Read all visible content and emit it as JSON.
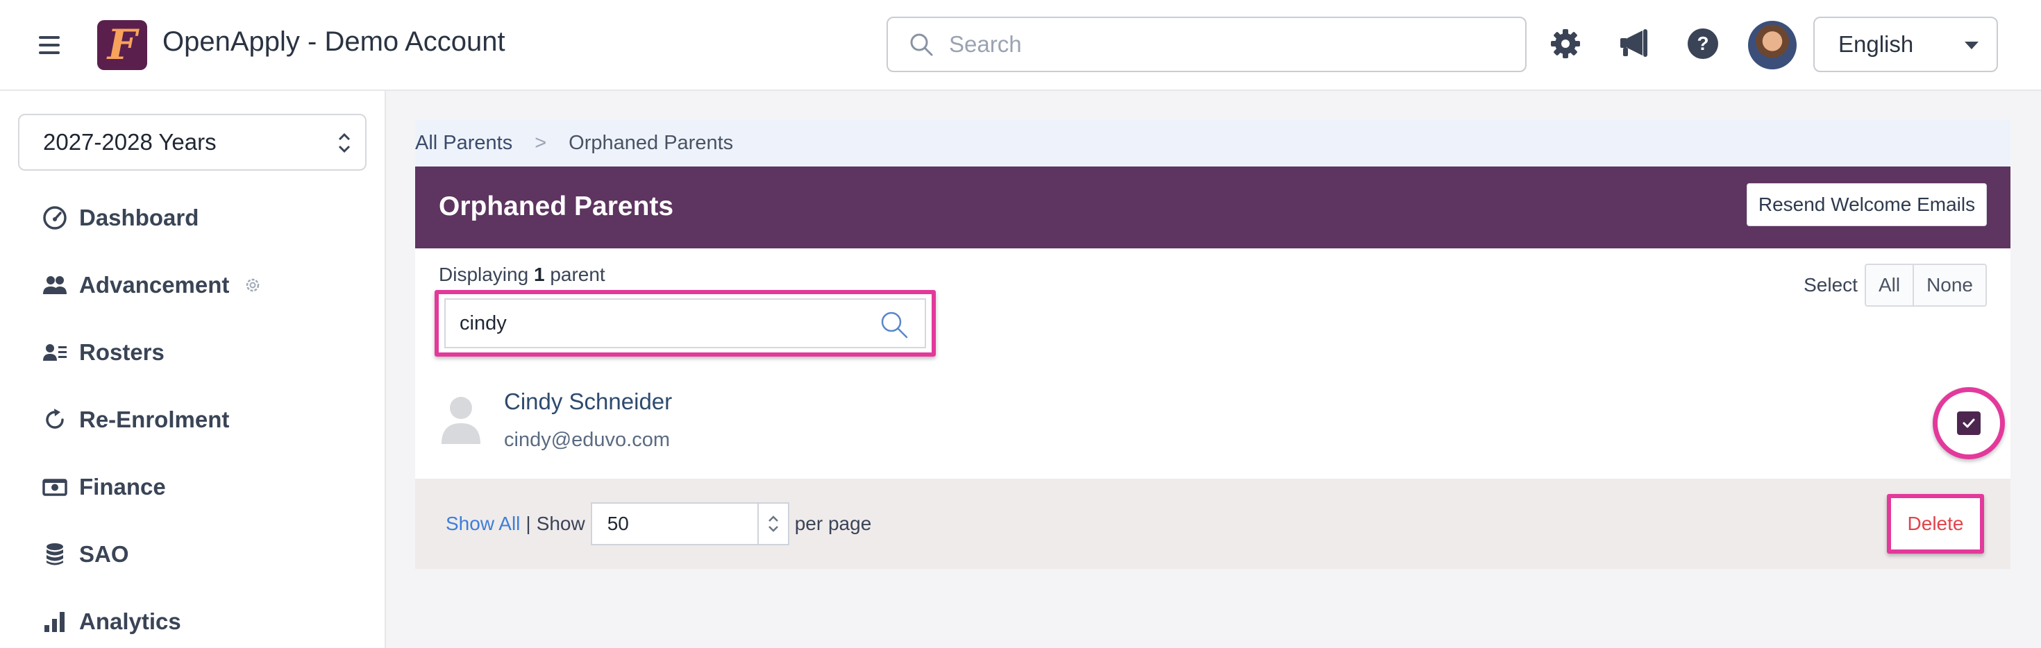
{
  "header": {
    "app_title": "OpenApply - Demo Account",
    "logo_letter": "F",
    "search_placeholder": "Search",
    "language": "English"
  },
  "sidebar": {
    "year": "2027-2028 Years",
    "items": [
      {
        "label": "Dashboard",
        "icon": "gauge-icon"
      },
      {
        "label": "Advancement",
        "icon": "users-icon"
      },
      {
        "label": "Rosters",
        "icon": "roster-icon"
      },
      {
        "label": "Re-Enrolment",
        "icon": "refresh-icon"
      },
      {
        "label": "Finance",
        "icon": "money-icon"
      },
      {
        "label": "SAO",
        "icon": "database-icon"
      },
      {
        "label": "Analytics",
        "icon": "bar-chart-icon"
      }
    ]
  },
  "breadcrumb": {
    "parent": "All Parents",
    "separator": ">",
    "current": "Orphaned Parents"
  },
  "panel": {
    "title": "Orphaned Parents",
    "resend_label": "Resend Welcome Emails",
    "displaying_prefix": "Displaying",
    "displaying_count": "1",
    "displaying_suffix": "parent",
    "select_label": "Select",
    "select_all": "All",
    "select_none": "None",
    "filter_value": "cindy"
  },
  "parents": [
    {
      "name": "Cindy Schneider",
      "email": "cindy@eduvo.com",
      "checked": true
    }
  ],
  "footer": {
    "show_all": "Show All",
    "pipe": "|",
    "show_label": "Show",
    "per_page_value": "50",
    "per_page_suffix": "per page",
    "delete_label": "Delete"
  },
  "colors": {
    "brand_purple": "#5e3460",
    "highlight_pink": "#e3399b",
    "delete_red": "#e2434b",
    "link_blue": "#3d7fd8"
  }
}
